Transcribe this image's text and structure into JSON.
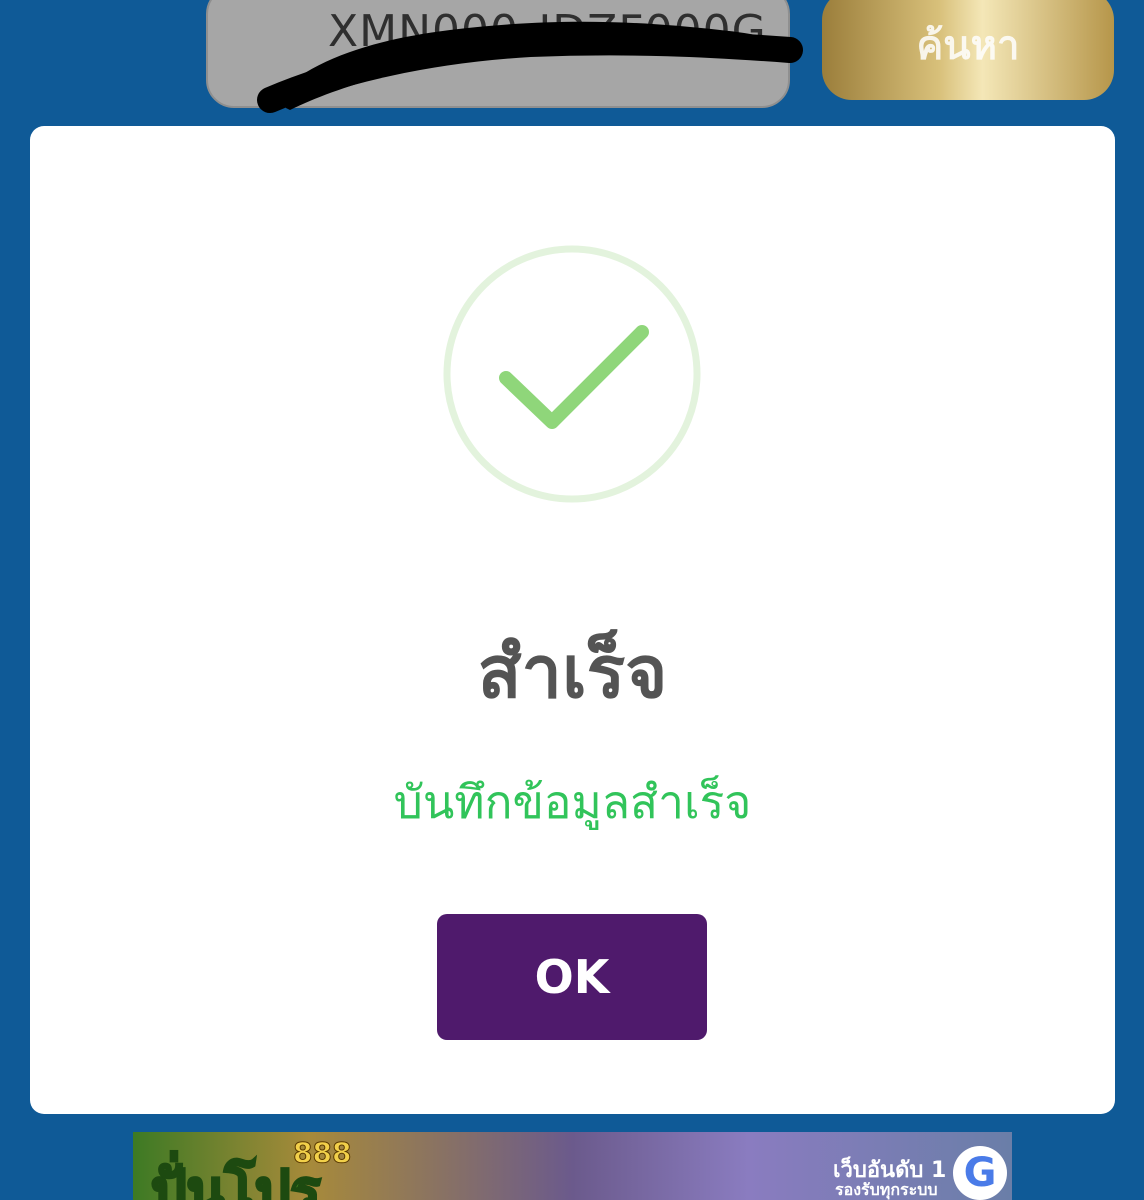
{
  "search": {
    "code_value": "XMN000-JDZF000G",
    "button_label": "ค้นหา"
  },
  "modal": {
    "title": "สำเร็จ",
    "message": "บันทึกข้อมูลสำเร็จ",
    "ok_label": "OK",
    "icon": "success-check-icon"
  },
  "banner": {
    "logo_text": "ปั่นโปร",
    "logo_number": "888",
    "tagline": "เว็บอันดับ 1",
    "subtagline": "รองรับทุกระบบ",
    "badge_letter": "G"
  },
  "colors": {
    "background": "#0f5a97",
    "success_green": "#31c45a",
    "ok_button": "#4f1a6c",
    "title_gray": "#545454"
  }
}
